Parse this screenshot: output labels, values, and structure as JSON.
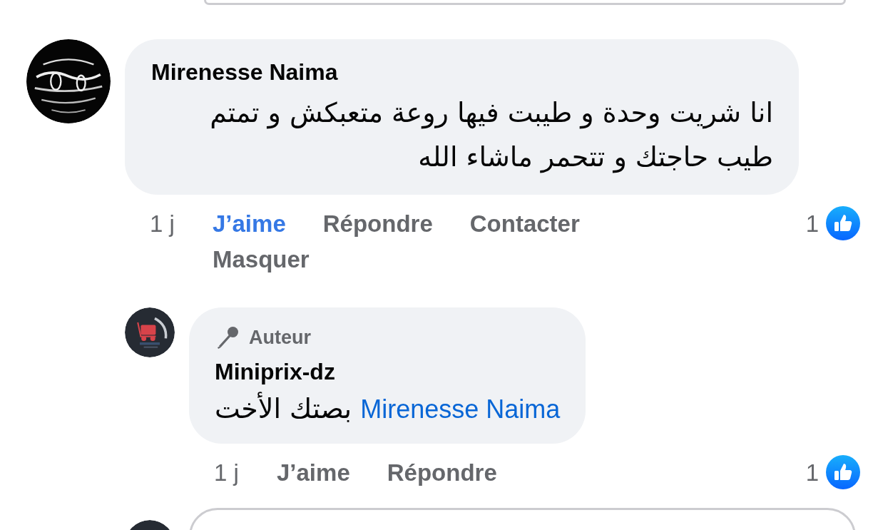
{
  "comments": [
    {
      "kind": "comment",
      "author": "Mirenesse Naima",
      "text": "انا شريت وحدة و طيبت فيها روعة متعبكش و تمتم طيب حاجتك و تتحمر  ماشاء الله",
      "time": "1 j",
      "liked": true,
      "actions": [
        "J’aime",
        "Répondre",
        "Contacter",
        "Masquer"
      ],
      "reaction_count": "1"
    },
    {
      "kind": "reply",
      "badge": "Auteur",
      "author": "Miniprix-dz",
      "mention": "Mirenesse Naima",
      "text": "بصتك الأخت",
      "time": "1 j",
      "liked": false,
      "actions": [
        "J’aime",
        "Répondre"
      ],
      "reaction_count": "1"
    }
  ]
}
